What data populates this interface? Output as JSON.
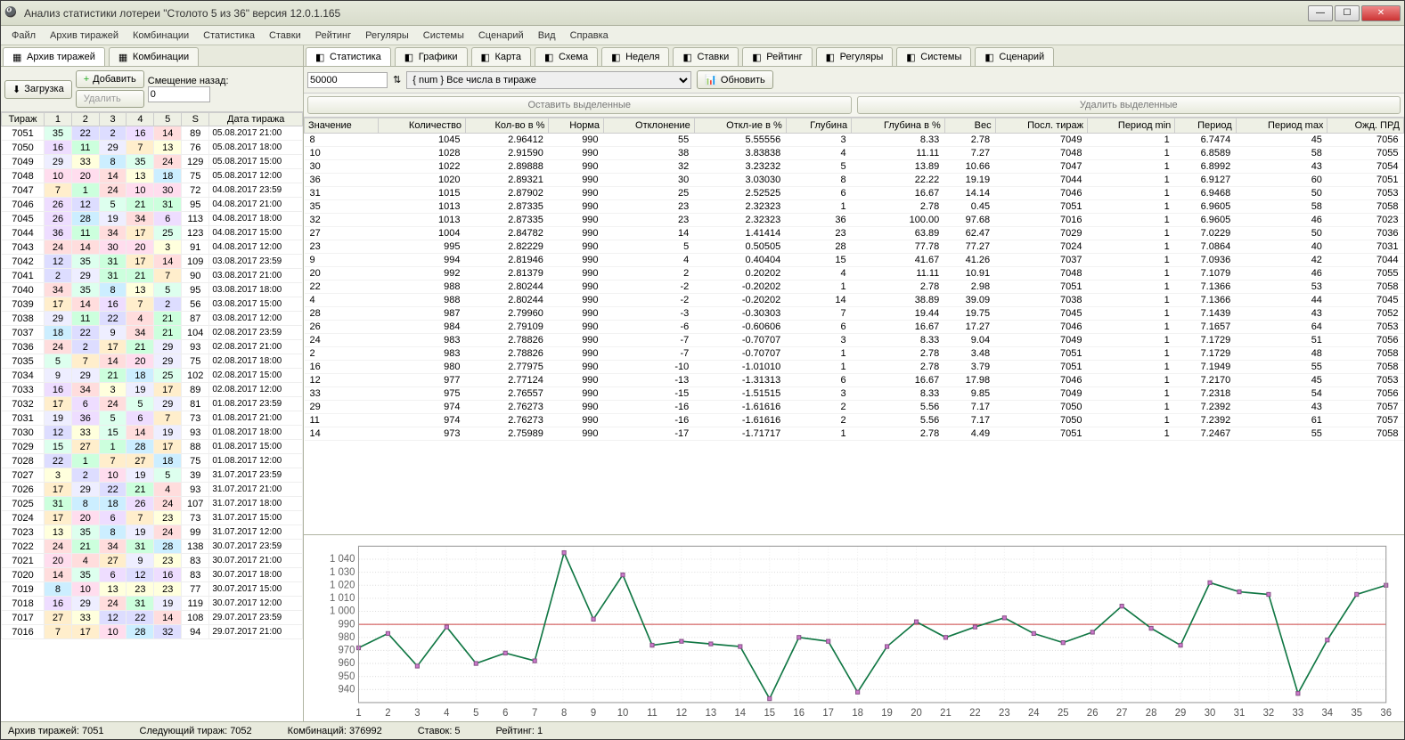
{
  "window": {
    "title": "Анализ статистики лотереи \"Столото 5 из 36\" версия 12.0.1.165"
  },
  "menu": [
    "Файл",
    "Архив тиражей",
    "Комбинации",
    "Статистика",
    "Ставки",
    "Рейтинг",
    "Регуляры",
    "Системы",
    "Сценарий",
    "Вид",
    "Справка"
  ],
  "left_tabs": [
    {
      "label": "Архив тиражей",
      "active": true,
      "icon": "table-icon"
    },
    {
      "label": "Комбинации",
      "active": false,
      "icon": "grid-icon"
    }
  ],
  "left_controls": {
    "load_label": "Загрузка",
    "add_label": "Добавить",
    "delete_label": "Удалить",
    "offset_label": "Смещение назад:",
    "offset_value": "0"
  },
  "archive_headers": [
    "Тираж",
    "1",
    "2",
    "3",
    "4",
    "5",
    "S",
    "Дата тиража"
  ],
  "archive_rows": [
    {
      "t": "7051",
      "n": [
        35,
        22,
        2,
        16,
        14
      ],
      "s": 89,
      "d": "05.08.2017 21:00"
    },
    {
      "t": "7050",
      "n": [
        16,
        11,
        29,
        7,
        13
      ],
      "s": 76,
      "d": "05.08.2017 18:00"
    },
    {
      "t": "7049",
      "n": [
        29,
        33,
        8,
        35,
        24
      ],
      "s": 129,
      "d": "05.08.2017 15:00"
    },
    {
      "t": "7048",
      "n": [
        10,
        20,
        14,
        13,
        18
      ],
      "s": 75,
      "d": "05.08.2017 12:00"
    },
    {
      "t": "7047",
      "n": [
        7,
        1,
        24,
        10,
        30
      ],
      "s": 72,
      "d": "04.08.2017 23:59"
    },
    {
      "t": "7046",
      "n": [
        26,
        12,
        5,
        21,
        31
      ],
      "s": 95,
      "d": "04.08.2017 21:00"
    },
    {
      "t": "7045",
      "n": [
        26,
        28,
        19,
        34,
        6
      ],
      "s": 113,
      "d": "04.08.2017 18:00"
    },
    {
      "t": "7044",
      "n": [
        36,
        11,
        34,
        17,
        25
      ],
      "s": 123,
      "d": "04.08.2017 15:00"
    },
    {
      "t": "7043",
      "n": [
        24,
        14,
        30,
        20,
        3
      ],
      "s": 91,
      "d": "04.08.2017 12:00"
    },
    {
      "t": "7042",
      "n": [
        12,
        35,
        31,
        17,
        14
      ],
      "s": 109,
      "d": "03.08.2017 23:59"
    },
    {
      "t": "7041",
      "n": [
        2,
        29,
        31,
        21,
        7
      ],
      "s": 90,
      "d": "03.08.2017 21:00"
    },
    {
      "t": "7040",
      "n": [
        34,
        35,
        8,
        13,
        5
      ],
      "s": 95,
      "d": "03.08.2017 18:00"
    },
    {
      "t": "7039",
      "n": [
        17,
        14,
        16,
        7,
        2
      ],
      "s": 56,
      "d": "03.08.2017 15:00"
    },
    {
      "t": "7038",
      "n": [
        29,
        11,
        22,
        4,
        21
      ],
      "s": 87,
      "d": "03.08.2017 12:00"
    },
    {
      "t": "7037",
      "n": [
        18,
        22,
        9,
        34,
        21
      ],
      "s": 104,
      "d": "02.08.2017 23:59"
    },
    {
      "t": "7036",
      "n": [
        24,
        2,
        17,
        21,
        29
      ],
      "s": 93,
      "d": "02.08.2017 21:00"
    },
    {
      "t": "7035",
      "n": [
        5,
        7,
        14,
        20,
        29
      ],
      "s": 75,
      "d": "02.08.2017 18:00"
    },
    {
      "t": "7034",
      "n": [
        9,
        29,
        21,
        18,
        25
      ],
      "s": 102,
      "d": "02.08.2017 15:00"
    },
    {
      "t": "7033",
      "n": [
        16,
        34,
        3,
        19,
        17
      ],
      "s": 89,
      "d": "02.08.2017 12:00"
    },
    {
      "t": "7032",
      "n": [
        17,
        6,
        24,
        5,
        29
      ],
      "s": 81,
      "d": "01.08.2017 23:59"
    },
    {
      "t": "7031",
      "n": [
        19,
        36,
        5,
        6,
        7
      ],
      "s": 73,
      "d": "01.08.2017 21:00"
    },
    {
      "t": "7030",
      "n": [
        12,
        33,
        15,
        14,
        19
      ],
      "s": 93,
      "d": "01.08.2017 18:00"
    },
    {
      "t": "7029",
      "n": [
        15,
        27,
        1,
        28,
        17
      ],
      "s": 88,
      "d": "01.08.2017 15:00"
    },
    {
      "t": "7028",
      "n": [
        22,
        1,
        7,
        27,
        18
      ],
      "s": 75,
      "d": "01.08.2017 12:00"
    },
    {
      "t": "7027",
      "n": [
        3,
        2,
        10,
        19,
        5
      ],
      "s": 39,
      "d": "31.07.2017 23:59"
    },
    {
      "t": "7026",
      "n": [
        17,
        29,
        22,
        21,
        4
      ],
      "s": 93,
      "d": "31.07.2017 21:00"
    },
    {
      "t": "7025",
      "n": [
        31,
        8,
        18,
        26,
        24
      ],
      "s": 107,
      "d": "31.07.2017 18:00"
    },
    {
      "t": "7024",
      "n": [
        17,
        20,
        6,
        7,
        23
      ],
      "s": 73,
      "d": "31.07.2017 15:00"
    },
    {
      "t": "7023",
      "n": [
        13,
        35,
        8,
        19,
        24
      ],
      "s": 99,
      "d": "31.07.2017 12:00"
    },
    {
      "t": "7022",
      "n": [
        24,
        21,
        34,
        31,
        28
      ],
      "s": 138,
      "d": "30.07.2017 23:59"
    },
    {
      "t": "7021",
      "n": [
        20,
        4,
        27,
        9,
        23
      ],
      "s": 83,
      "d": "30.07.2017 21:00"
    },
    {
      "t": "7020",
      "n": [
        14,
        35,
        6,
        12,
        16
      ],
      "s": 83,
      "d": "30.07.2017 18:00"
    },
    {
      "t": "7019",
      "n": [
        8,
        10,
        13,
        23,
        23
      ],
      "s": 77,
      "d": "30.07.2017 15:00"
    },
    {
      "t": "7018",
      "n": [
        16,
        29,
        24,
        31,
        19
      ],
      "s": 119,
      "d": "30.07.2017 12:00"
    },
    {
      "t": "7017",
      "n": [
        27,
        33,
        12,
        22,
        14
      ],
      "s": 108,
      "d": "29.07.2017 23:59"
    },
    {
      "t": "7016",
      "n": [
        7,
        17,
        10,
        28,
        32
      ],
      "s": 94,
      "d": "29.07.2017 21:00"
    }
  ],
  "right_tabs": [
    {
      "label": "Статистика",
      "icon": "bars-icon",
      "active": true
    },
    {
      "label": "Графики",
      "icon": "chart-icon"
    },
    {
      "label": "Карта",
      "icon": "map-icon"
    },
    {
      "label": "Схема",
      "icon": "grid-icon"
    },
    {
      "label": "Неделя",
      "icon": "calendar-icon"
    },
    {
      "label": "Ставки",
      "icon": "coin-icon"
    },
    {
      "label": "Рейтинг",
      "icon": "trophy-icon"
    },
    {
      "label": "Регуляры",
      "icon": "loop-icon"
    },
    {
      "label": "Системы",
      "icon": "gear-icon"
    },
    {
      "label": "Сценарий",
      "icon": "script-icon"
    }
  ],
  "right_controls": {
    "count_value": "50000",
    "filter_value": "{ num } Все числа в тираже",
    "refresh_label": "Обновить",
    "keep_selected_label": "Оставить выделенные",
    "delete_selected_label": "Удалить выделенные"
  },
  "stat_headers": [
    "Значение",
    "Количество",
    "Кол-во в %",
    "Норма",
    "Отклонение",
    "Откл-ие в %",
    "Глубина",
    "Глубина в %",
    "Вес",
    "Посл. тираж",
    "Период min",
    "Период",
    "Период max",
    "Ожд. ПРД"
  ],
  "stat_rows": [
    [
      "8",
      "1045",
      "2.96412",
      "990",
      "55",
      "5.55556",
      "3",
      "8.33",
      "2.78",
      "7049",
      "1",
      "6.7474",
      "45",
      "7056"
    ],
    [
      "10",
      "1028",
      "2.91590",
      "990",
      "38",
      "3.83838",
      "4",
      "11.11",
      "7.27",
      "7048",
      "1",
      "6.8589",
      "58",
      "7055"
    ],
    [
      "30",
      "1022",
      "2.89888",
      "990",
      "32",
      "3.23232",
      "5",
      "13.89",
      "10.66",
      "7047",
      "1",
      "6.8992",
      "43",
      "7054"
    ],
    [
      "36",
      "1020",
      "2.89321",
      "990",
      "30",
      "3.03030",
      "8",
      "22.22",
      "19.19",
      "7044",
      "1",
      "6.9127",
      "60",
      "7051"
    ],
    [
      "31",
      "1015",
      "2.87902",
      "990",
      "25",
      "2.52525",
      "6",
      "16.67",
      "14.14",
      "7046",
      "1",
      "6.9468",
      "50",
      "7053"
    ],
    [
      "35",
      "1013",
      "2.87335",
      "990",
      "23",
      "2.32323",
      "1",
      "2.78",
      "0.45",
      "7051",
      "1",
      "6.9605",
      "58",
      "7058"
    ],
    [
      "32",
      "1013",
      "2.87335",
      "990",
      "23",
      "2.32323",
      "36",
      "100.00",
      "97.68",
      "7016",
      "1",
      "6.9605",
      "46",
      "7023"
    ],
    [
      "27",
      "1004",
      "2.84782",
      "990",
      "14",
      "1.41414",
      "23",
      "63.89",
      "62.47",
      "7029",
      "1",
      "7.0229",
      "50",
      "7036"
    ],
    [
      "23",
      "995",
      "2.82229",
      "990",
      "5",
      "0.50505",
      "28",
      "77.78",
      "77.27",
      "7024",
      "1",
      "7.0864",
      "40",
      "7031"
    ],
    [
      "9",
      "994",
      "2.81946",
      "990",
      "4",
      "0.40404",
      "15",
      "41.67",
      "41.26",
      "7037",
      "1",
      "7.0936",
      "42",
      "7044"
    ],
    [
      "20",
      "992",
      "2.81379",
      "990",
      "2",
      "0.20202",
      "4",
      "11.11",
      "10.91",
      "7048",
      "1",
      "7.1079",
      "46",
      "7055"
    ],
    [
      "22",
      "988",
      "2.80244",
      "990",
      "-2",
      "-0.20202",
      "1",
      "2.78",
      "2.98",
      "7051",
      "1",
      "7.1366",
      "53",
      "7058"
    ],
    [
      "4",
      "988",
      "2.80244",
      "990",
      "-2",
      "-0.20202",
      "14",
      "38.89",
      "39.09",
      "7038",
      "1",
      "7.1366",
      "44",
      "7045"
    ],
    [
      "28",
      "987",
      "2.79960",
      "990",
      "-3",
      "-0.30303",
      "7",
      "19.44",
      "19.75",
      "7045",
      "1",
      "7.1439",
      "43",
      "7052"
    ],
    [
      "26",
      "984",
      "2.79109",
      "990",
      "-6",
      "-0.60606",
      "6",
      "16.67",
      "17.27",
      "7046",
      "1",
      "7.1657",
      "64",
      "7053"
    ],
    [
      "24",
      "983",
      "2.78826",
      "990",
      "-7",
      "-0.70707",
      "3",
      "8.33",
      "9.04",
      "7049",
      "1",
      "7.1729",
      "51",
      "7056"
    ],
    [
      "2",
      "983",
      "2.78826",
      "990",
      "-7",
      "-0.70707",
      "1",
      "2.78",
      "3.48",
      "7051",
      "1",
      "7.1729",
      "48",
      "7058"
    ],
    [
      "16",
      "980",
      "2.77975",
      "990",
      "-10",
      "-1.01010",
      "1",
      "2.78",
      "3.79",
      "7051",
      "1",
      "7.1949",
      "55",
      "7058"
    ],
    [
      "12",
      "977",
      "2.77124",
      "990",
      "-13",
      "-1.31313",
      "6",
      "16.67",
      "17.98",
      "7046",
      "1",
      "7.2170",
      "45",
      "7053"
    ],
    [
      "33",
      "975",
      "2.76557",
      "990",
      "-15",
      "-1.51515",
      "3",
      "8.33",
      "9.85",
      "7049",
      "1",
      "7.2318",
      "54",
      "7056"
    ],
    [
      "29",
      "974",
      "2.76273",
      "990",
      "-16",
      "-1.61616",
      "2",
      "5.56",
      "7.17",
      "7050",
      "1",
      "7.2392",
      "43",
      "7057"
    ],
    [
      "11",
      "974",
      "2.76273",
      "990",
      "-16",
      "-1.61616",
      "2",
      "5.56",
      "7.17",
      "7050",
      "1",
      "7.2392",
      "61",
      "7057"
    ],
    [
      "14",
      "973",
      "2.75989",
      "990",
      "-17",
      "-1.71717",
      "1",
      "2.78",
      "4.49",
      "7051",
      "1",
      "7.2467",
      "55",
      "7058"
    ]
  ],
  "statusbar": {
    "archive": "Архив тиражей: 7051",
    "next": "Следующий тираж: 7052",
    "combos": "Комбинаций: 376992",
    "bets": "Ставок: 5",
    "rating": "Рейтинг: 1"
  },
  "chart_data": {
    "type": "line",
    "title": "",
    "xlabel": "",
    "ylabel": "",
    "ylim": [
      930,
      1050
    ],
    "y_ticks": [
      940,
      950,
      960,
      970,
      980,
      990,
      1000,
      1010,
      1020,
      1030,
      1040
    ],
    "x": [
      1,
      2,
      3,
      4,
      5,
      6,
      7,
      8,
      9,
      10,
      11,
      12,
      13,
      14,
      15,
      16,
      17,
      18,
      19,
      20,
      21,
      22,
      23,
      24,
      25,
      26,
      27,
      28,
      29,
      30,
      31,
      32,
      33,
      34,
      35,
      36
    ],
    "reference": 990,
    "series": [
      {
        "name": "Количество",
        "values": [
          972,
          983,
          958,
          988,
          960,
          968,
          962,
          1045,
          994,
          1028,
          974,
          977,
          975,
          973,
          933,
          980,
          977,
          938,
          973,
          992,
          980,
          988,
          995,
          983,
          976,
          984,
          1004,
          987,
          974,
          1022,
          1015,
          1013,
          937,
          978,
          1013,
          1020
        ]
      }
    ]
  }
}
